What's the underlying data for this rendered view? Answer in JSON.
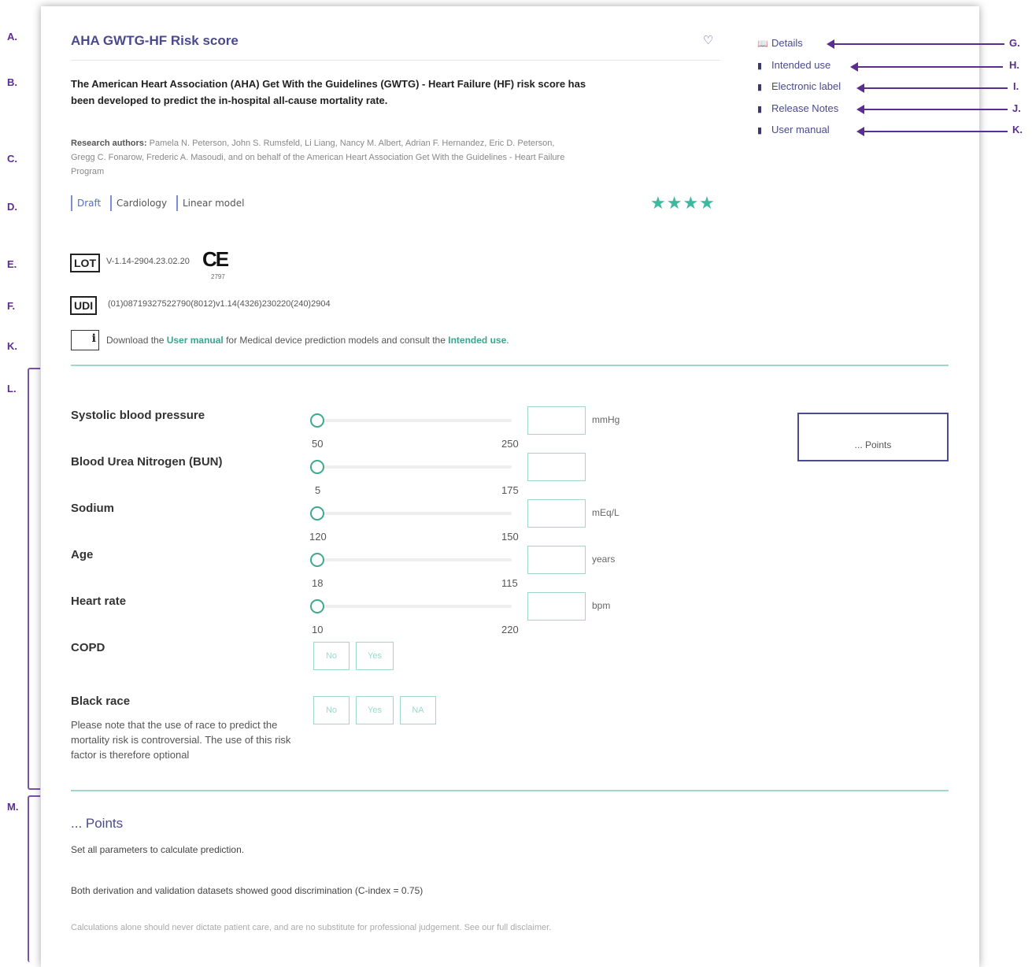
{
  "annotations": {
    "left": [
      "A.",
      "B.",
      "C.",
      "D.",
      "E.",
      "F.",
      "K.",
      "L.",
      "M."
    ],
    "right": [
      "G.",
      "H.",
      "I.",
      "J.",
      "K."
    ]
  },
  "header": {
    "title": "AHA GWTG-HF Risk score",
    "favorite_icon": "heart-icon",
    "description": "The American Heart Association (AHA) Get With the Guidelines (GWTG) - Heart Failure (HF) risk score has been developed to predict the in-hospital all-cause mortality rate.",
    "authors_label": "Research authors:",
    "authors": "Pamela N. Peterson, John S. Rumsfeld, Li Liang, Nancy M. Albert, Adrian F. Hernandez, Eric D. Peterson, Gregg C. Fonarow, Frederic A. Masoudi, and on behalf of the American Heart Association Get With the Guidelines - Heart Failure Program"
  },
  "tags": [
    "Draft",
    "Cardiology",
    "Linear model"
  ],
  "rating": {
    "stars": 4,
    "glyphs": "★★★★",
    "color": "#3fb8a0"
  },
  "side_links": [
    {
      "label": "Details",
      "icon": "book-icon"
    },
    {
      "label": "Intended use",
      "icon": "document-icon"
    },
    {
      "label": "Electronic label",
      "icon": "document-icon"
    },
    {
      "label": "Release Notes",
      "icon": "document-icon"
    },
    {
      "label": "User manual",
      "icon": "document-icon"
    }
  ],
  "regulatory": {
    "lot_symbol": "LOT",
    "lot_value": "V-1.14-2904.23.02.20",
    "ce_mark": "CE",
    "ce_number": "2797",
    "udi_symbol": "UDI",
    "udi_value": "(01)08719327522790(8012)v1.14(4326)230220(240)2904",
    "manual_prefix": "Download the ",
    "manual_link": "User manual",
    "manual_middle": " for Medical device prediction models and consult the ",
    "intended_link": "Intended use",
    "manual_suffix": "."
  },
  "parameters": [
    {
      "label": "Systolic blood pressure",
      "min": "50",
      "max": "250",
      "unit": "mmHg"
    },
    {
      "label": "Blood Urea Nitrogen (BUN)",
      "min": "5",
      "max": "175",
      "unit": ""
    },
    {
      "label": "Sodium",
      "min": "120",
      "max": "150",
      "unit": "mEq/L"
    },
    {
      "label": "Age",
      "min": "18",
      "max": "115",
      "unit": "years"
    },
    {
      "label": "Heart rate",
      "min": "10",
      "max": "220",
      "unit": "bpm"
    }
  ],
  "copd": {
    "label": "COPD",
    "options": [
      "No",
      "Yes"
    ]
  },
  "race": {
    "label": "Black race",
    "options": [
      "No",
      "Yes",
      "NA"
    ],
    "note": "Please note that the use of race to predict the mortality risk is controversial. The use of this risk factor is therefore optional"
  },
  "points_box": {
    "text": "... Points"
  },
  "result": {
    "title": "... Points",
    "prompt": "Set all parameters to calculate prediction.",
    "validation": "Both derivation and validation datasets showed good discrimination (C-index = 0.75)",
    "disclaimer": "Calculations alone should never dictate patient care, and are no substitute for professional judgement. See our full disclaimer."
  },
  "colors": {
    "accent": "#4a4a8f",
    "teal": "#3fa88f",
    "annotation": "#5b2d91"
  }
}
